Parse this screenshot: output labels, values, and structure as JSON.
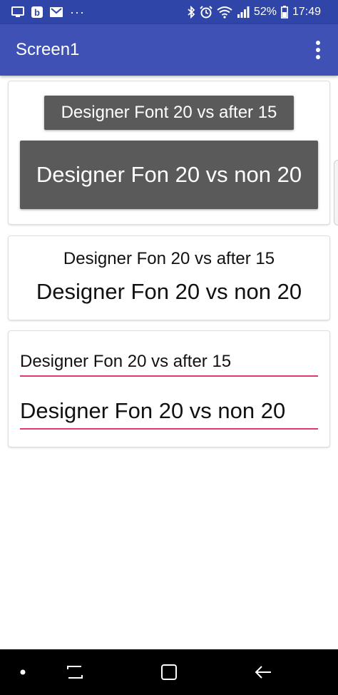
{
  "status_bar": {
    "battery": "52%",
    "time": "17:49",
    "more": "···"
  },
  "app_bar": {
    "title": "Screen1"
  },
  "card1": {
    "button_small": "Designer Font 20 vs after 15",
    "button_large": "Designer Fon 20 vs non 20"
  },
  "card2": {
    "label_small": "Designer Fon 20 vs after 15",
    "label_large": "Designer Fon 20 vs non 20"
  },
  "card3": {
    "field_small": "Designer Fon 20 vs after 15",
    "field_large": "Designer Fon 20 vs non 20"
  },
  "colors": {
    "status_bar": "#2f45a7",
    "app_bar": "#3f51b5",
    "button": "#5a5a5a",
    "field_underline": "#e2386b"
  }
}
